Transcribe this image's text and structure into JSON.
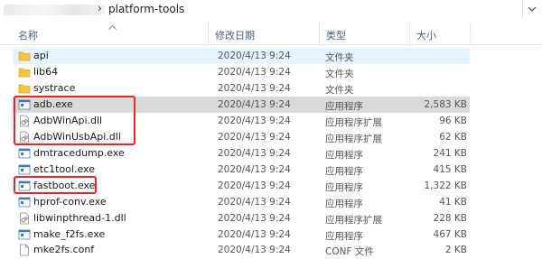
{
  "address_bar": {
    "separator": "›",
    "path": "platform-tools"
  },
  "columns": {
    "name": "名称",
    "modified": "修改日期",
    "type": "类型",
    "size": "大小"
  },
  "files": [
    {
      "name": "api",
      "date": "2020/4/13 9:24",
      "type": "文件夹",
      "size": "",
      "icon": "folder-icon"
    },
    {
      "name": "lib64",
      "date": "2020/4/13 9:24",
      "type": "文件夹",
      "size": "",
      "icon": "folder-icon"
    },
    {
      "name": "systrace",
      "date": "2020/4/13 9:24",
      "type": "文件夹",
      "size": "",
      "icon": "folder-icon"
    },
    {
      "name": "adb.exe",
      "date": "2020/4/13 9:24",
      "type": "应用程序",
      "size": "2,583 KB",
      "icon": "exe-icon"
    },
    {
      "name": "AdbWinApi.dll",
      "date": "2020/4/13 9:24",
      "type": "应用程序扩展",
      "size": "96 KB",
      "icon": "dll-icon"
    },
    {
      "name": "AdbWinUsbApi.dll",
      "date": "2020/4/13 9:24",
      "type": "应用程序扩展",
      "size": "62 KB",
      "icon": "dll-icon"
    },
    {
      "name": "dmtracedump.exe",
      "date": "2020/4/13 9:24",
      "type": "应用程序",
      "size": "241 KB",
      "icon": "exe-icon"
    },
    {
      "name": "etc1tool.exe",
      "date": "2020/4/13 9:24",
      "type": "应用程序",
      "size": "415 KB",
      "icon": "exe-icon"
    },
    {
      "name": "fastboot.exe",
      "date": "2020/4/13 9:24",
      "type": "应用程序",
      "size": "1,322 KB",
      "icon": "exe-icon"
    },
    {
      "name": "hprof-conv.exe",
      "date": "2020/4/13 9:24",
      "type": "应用程序",
      "size": "41 KB",
      "icon": "exe-icon"
    },
    {
      "name": "libwinpthread-1.dll",
      "date": "2020/4/13 9:24",
      "type": "应用程序扩展",
      "size": "228 KB",
      "icon": "dll-icon"
    },
    {
      "name": "make_f2fs.exe",
      "date": "2020/4/13 9:24",
      "type": "应用程序",
      "size": "467 KB",
      "icon": "exe-icon"
    },
    {
      "name": "mke2fs.conf",
      "date": "2020/4/13 9:24",
      "type": "CONF 文件",
      "size": "2 KB",
      "icon": "file-icon"
    }
  ],
  "colors": {
    "highlight": "#e8262a",
    "selected_row": "#d9d9d9",
    "hover_row": "#e5f3ff",
    "folder": "#f5c542"
  }
}
